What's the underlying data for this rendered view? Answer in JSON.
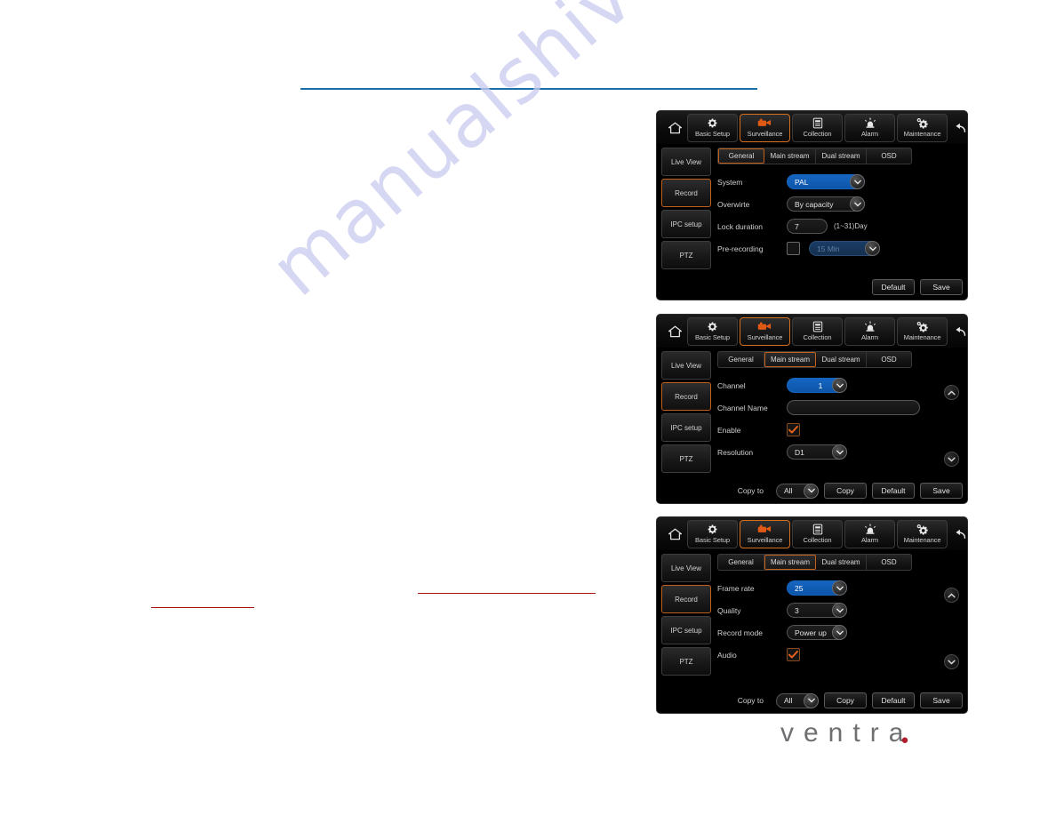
{
  "page": {
    "watermark_text": "manualshive.com",
    "brand": "ventra",
    "brand_dot": "."
  },
  "toolbar": {
    "home_icon": "home-icon",
    "back_icon": "back-arrow-icon",
    "items": [
      {
        "label": "Basic Setup",
        "icon": "gear-icon",
        "active": false
      },
      {
        "label": "Surveillance",
        "icon": "video-camera-icon",
        "active": true
      },
      {
        "label": "Collection",
        "icon": "document-list-icon",
        "active": false
      },
      {
        "label": "Alarm",
        "icon": "siren-icon",
        "active": false
      },
      {
        "label": "Maintenance",
        "icon": "gear-wrench-icon",
        "active": false
      }
    ]
  },
  "sidebar": {
    "items": [
      {
        "label": "Live View",
        "active": false
      },
      {
        "label": "Record",
        "active": true
      },
      {
        "label": "IPC setup",
        "active": false
      },
      {
        "label": "PTZ",
        "active": false
      }
    ]
  },
  "tabs": [
    {
      "label": "General"
    },
    {
      "label": "Main stream"
    },
    {
      "label": "Dual stream"
    },
    {
      "label": "OSD"
    }
  ],
  "panel1": {
    "active_tab": "General",
    "rows": {
      "system_label": "System",
      "system_value": "PAL",
      "overwrite_label": "Overwirte",
      "overwrite_value": "By capacity",
      "lock_label": "Lock duration",
      "lock_value": "7",
      "lock_hint": "(1~31)Day",
      "prerec_label": "Pre-recording",
      "prerec_checked": false,
      "prerec_value": "15 Min"
    },
    "buttons": {
      "default": "Default",
      "save": "Save"
    }
  },
  "panel2": {
    "active_tab": "Main stream",
    "rows": {
      "channel_label": "Channel",
      "channel_value": "1",
      "channel_name_label": "Channel Name",
      "channel_name_value": "",
      "enable_label": "Enable",
      "enable_checked": true,
      "resolution_label": "Resolution",
      "resolution_value": "D1"
    },
    "footer": {
      "copy_to_label": "Copy to",
      "copy_to_value": "All",
      "copy": "Copy",
      "default": "Default",
      "save": "Save"
    }
  },
  "panel3": {
    "active_tab": "Main stream",
    "rows": {
      "frame_rate_label": "Frame rate",
      "frame_rate_value": "25",
      "quality_label": "Quality",
      "quality_value": "3",
      "record_mode_label": "Record mode",
      "record_mode_value": "Power up",
      "audio_label": "Audio",
      "audio_checked": true
    },
    "footer": {
      "copy_to_label": "Copy to",
      "copy_to_value": "All",
      "copy": "Copy",
      "default": "Default",
      "save": "Save"
    }
  }
}
